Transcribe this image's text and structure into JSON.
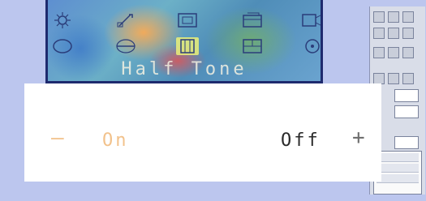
{
  "artwork": {
    "caption": "Half Tone",
    "icons_row1": [
      "sun-icon",
      "brush-icon",
      "frame-icon",
      "tile-icon",
      "camera-icon"
    ],
    "icons_row2": [
      "ellipse-icon",
      "line-icon",
      "halftone-icon",
      "layout-icon",
      "circle-icon"
    ],
    "selected_icon": "halftone-icon"
  },
  "toggle": {
    "minus_label": "—",
    "on_label": "On",
    "off_label": "Off",
    "plus_label": "+",
    "state": "off"
  },
  "colors": {
    "background": "#bcc6ee",
    "panel": "#ffffff",
    "on_accent": "#f2c28c",
    "off_text": "#2a2a2a",
    "art_border": "#1e2a6e"
  }
}
